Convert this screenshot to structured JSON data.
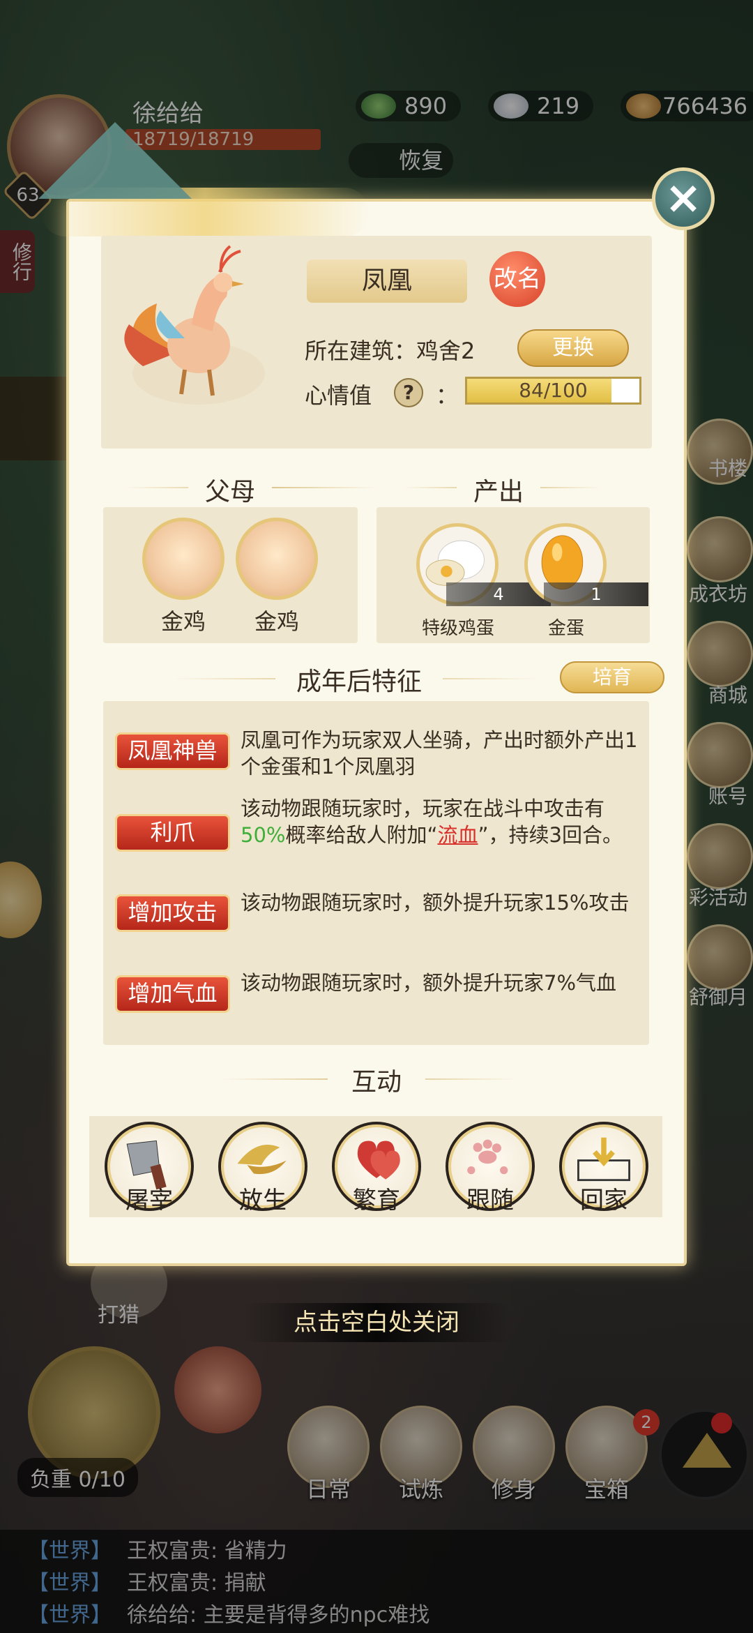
{
  "hud": {
    "player_name": "徐给给",
    "level": "63",
    "hp": "18719/18719",
    "currency_1": "890",
    "currency_2": "219",
    "currency_3": "766436",
    "recover_label": "恢复",
    "side_tab": "修行",
    "right_buttons": [
      "书楼",
      "成衣坊",
      "商城",
      "账号",
      "彩活动",
      "舒御月"
    ],
    "hunt_label": "打猎",
    "load": "负重 0/10",
    "bottom_nav": [
      "日常",
      "试炼",
      "修身",
      "宝箱"
    ],
    "chest_badge": "2"
  },
  "dialog": {
    "pet_name": "凤凰",
    "rename_label": "改名",
    "building_label": "所在建筑：鸡舍2",
    "change_label": "更换",
    "mood_label": "心情值",
    "mood_help": "?",
    "mood_colon": "：",
    "mood_value": "84/100",
    "mood_fraction": 0.84,
    "parents_title": "父母",
    "parents": [
      "金鸡",
      "金鸡"
    ],
    "output_title": "产出",
    "outputs": [
      {
        "name": "特级鸡蛋",
        "count": "4"
      },
      {
        "name": "金蛋",
        "count": "1"
      }
    ],
    "traits_title": "成年后特征",
    "breed_label": "培育",
    "traits": [
      {
        "tag": "凤凰神兽",
        "desc": "凤凰可作为玩家双人坐骑，产出时额外产出1个金蛋和1个凤凰羽"
      },
      {
        "tag": "利爪",
        "desc_pre": "该动物跟随玩家时，玩家在战斗中攻击有",
        "desc_pct": "50%",
        "desc_mid": "概率给敌人附加“",
        "desc_link": "流血",
        "desc_post": "”，持续3回合。"
      },
      {
        "tag": "增加攻击",
        "desc": "该动物跟随玩家时，额外提升玩家15%攻击"
      },
      {
        "tag": "增加气血",
        "desc": "该动物跟随玩家时，额外提升玩家7%气血"
      }
    ],
    "interact_title": "互动",
    "actions": [
      "屠宰",
      "放生",
      "繁育",
      "跟随",
      "回家"
    ],
    "close_hint": "点击空白处关闭"
  },
  "chat": [
    {
      "channel": "【世界】",
      "text": "王权富贵: 省精力"
    },
    {
      "channel": "【世界】",
      "text": "王权富贵: 捐献"
    },
    {
      "channel": "【世界】",
      "text": "徐给给: 主要是背得多的npc难找"
    }
  ],
  "colors": {
    "accent_gold": "#d7a644",
    "trait_red": "#c9311f",
    "panel_bg": "#fbf8ec",
    "card_bg": "#efe6cf"
  }
}
